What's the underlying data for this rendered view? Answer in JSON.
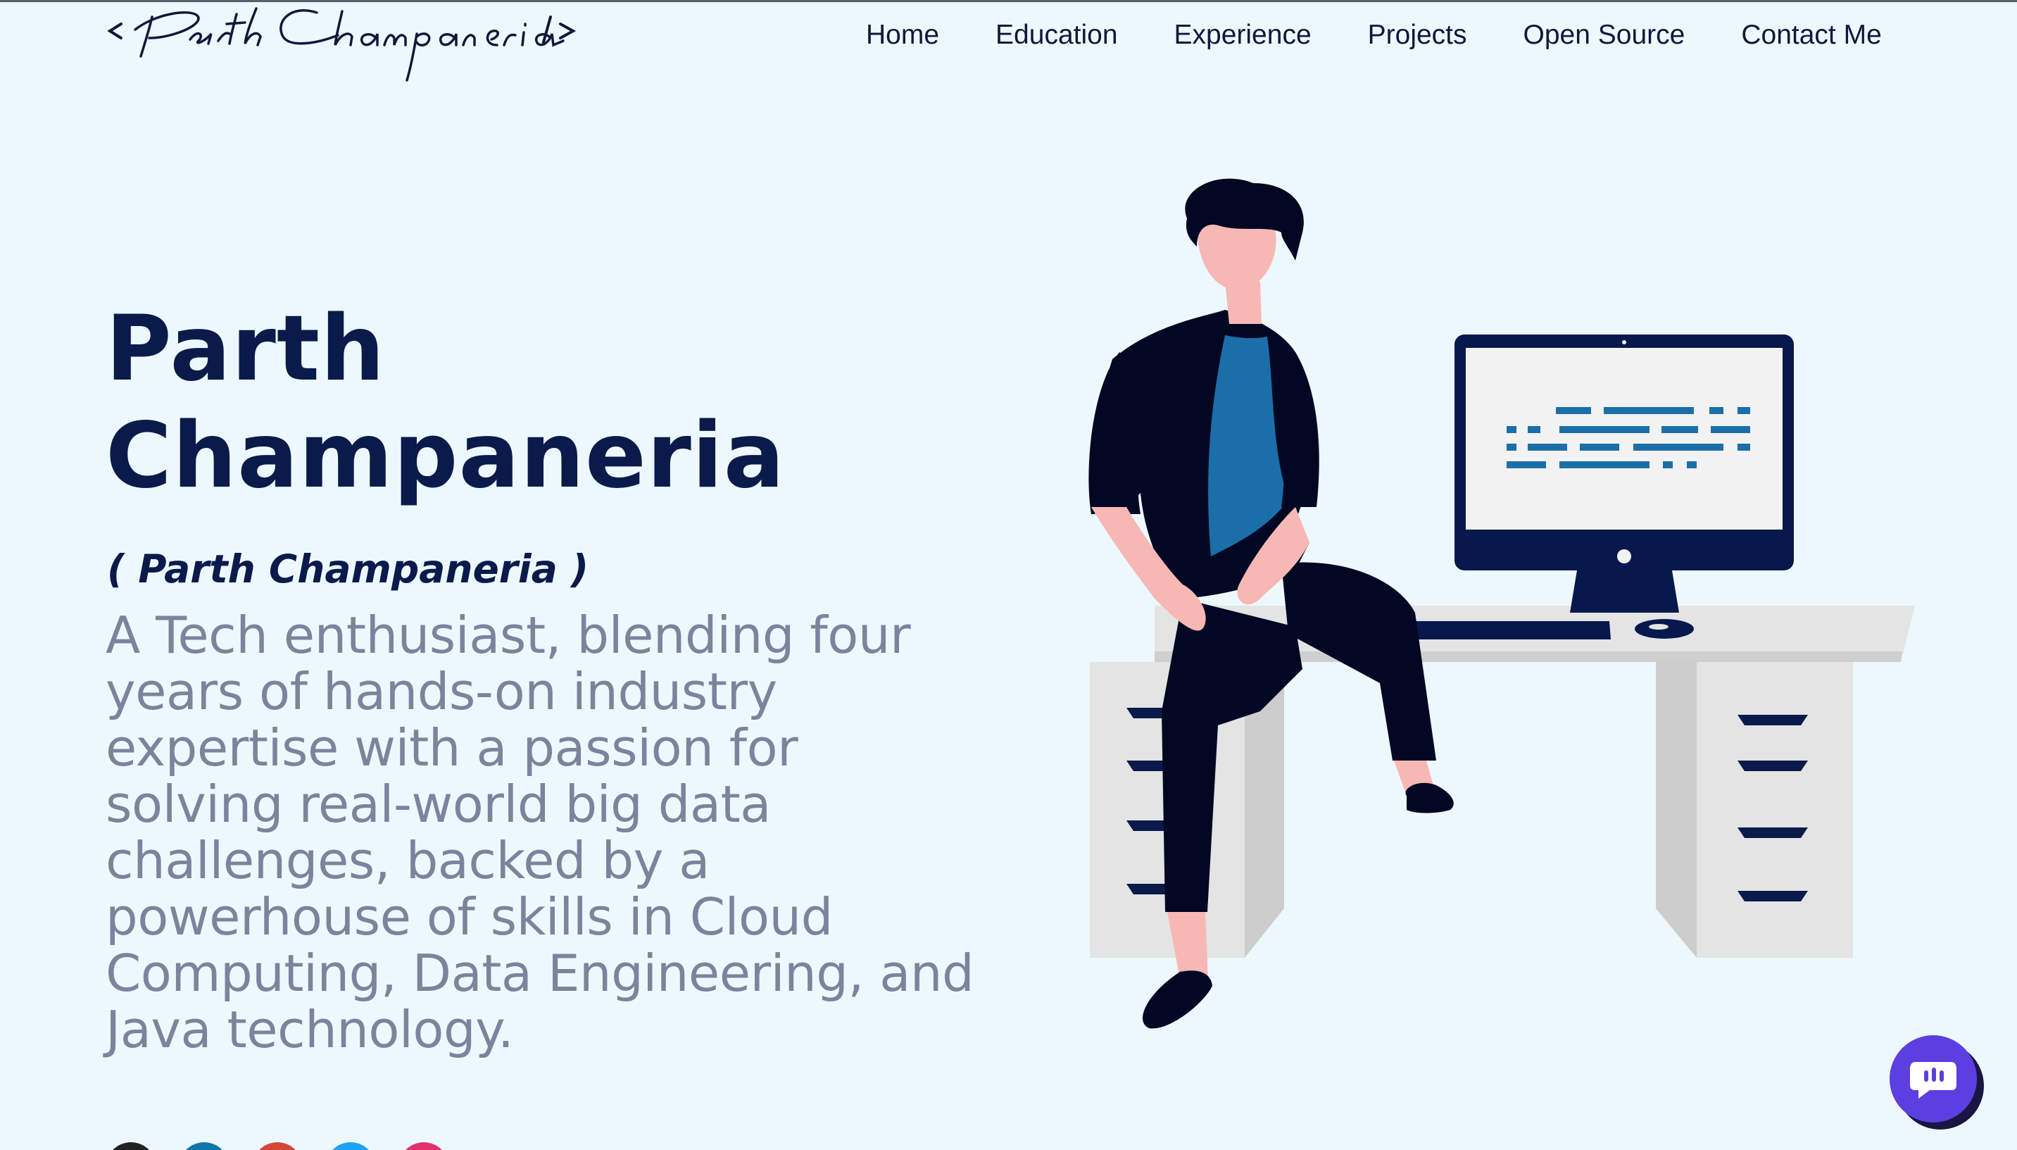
{
  "header": {
    "logo_text": "< Parth Champaneria />",
    "nav": [
      {
        "label": "Home"
      },
      {
        "label": "Education"
      },
      {
        "label": "Experience"
      },
      {
        "label": "Projects"
      },
      {
        "label": "Open Source"
      },
      {
        "label": "Contact Me"
      }
    ]
  },
  "greeting": {
    "title_line1": "Parth",
    "title_line2": "Champaneria",
    "nickname": "( Parth Champaneria )",
    "description": "A Tech enthusiast, blending four years of hands-on industry expertise with a passion for solving real-world big data challenges, backed by a powerhouse of skills in Cloud Computing, Data Engineering, and Java technology."
  },
  "social": [
    {
      "icon": "github-icon",
      "color": "#222222"
    },
    {
      "icon": "linkedin-icon",
      "color": "#0e76a8"
    },
    {
      "icon": "google-icon",
      "color": "#d44638"
    },
    {
      "icon": "twitter-icon",
      "color": "#1da1f2"
    },
    {
      "icon": "instagram-icon",
      "color": "#e1306c"
    }
  ],
  "chat": {
    "icon": "chat-icon",
    "color": "#5b3fe0"
  },
  "colors": {
    "background": "#edf8fe",
    "title": "#0a1a4a",
    "description": "#7b849c",
    "illustration_dark": "#020823",
    "illustration_blue": "#1b6fa8",
    "desk": "#e4e4e4"
  }
}
